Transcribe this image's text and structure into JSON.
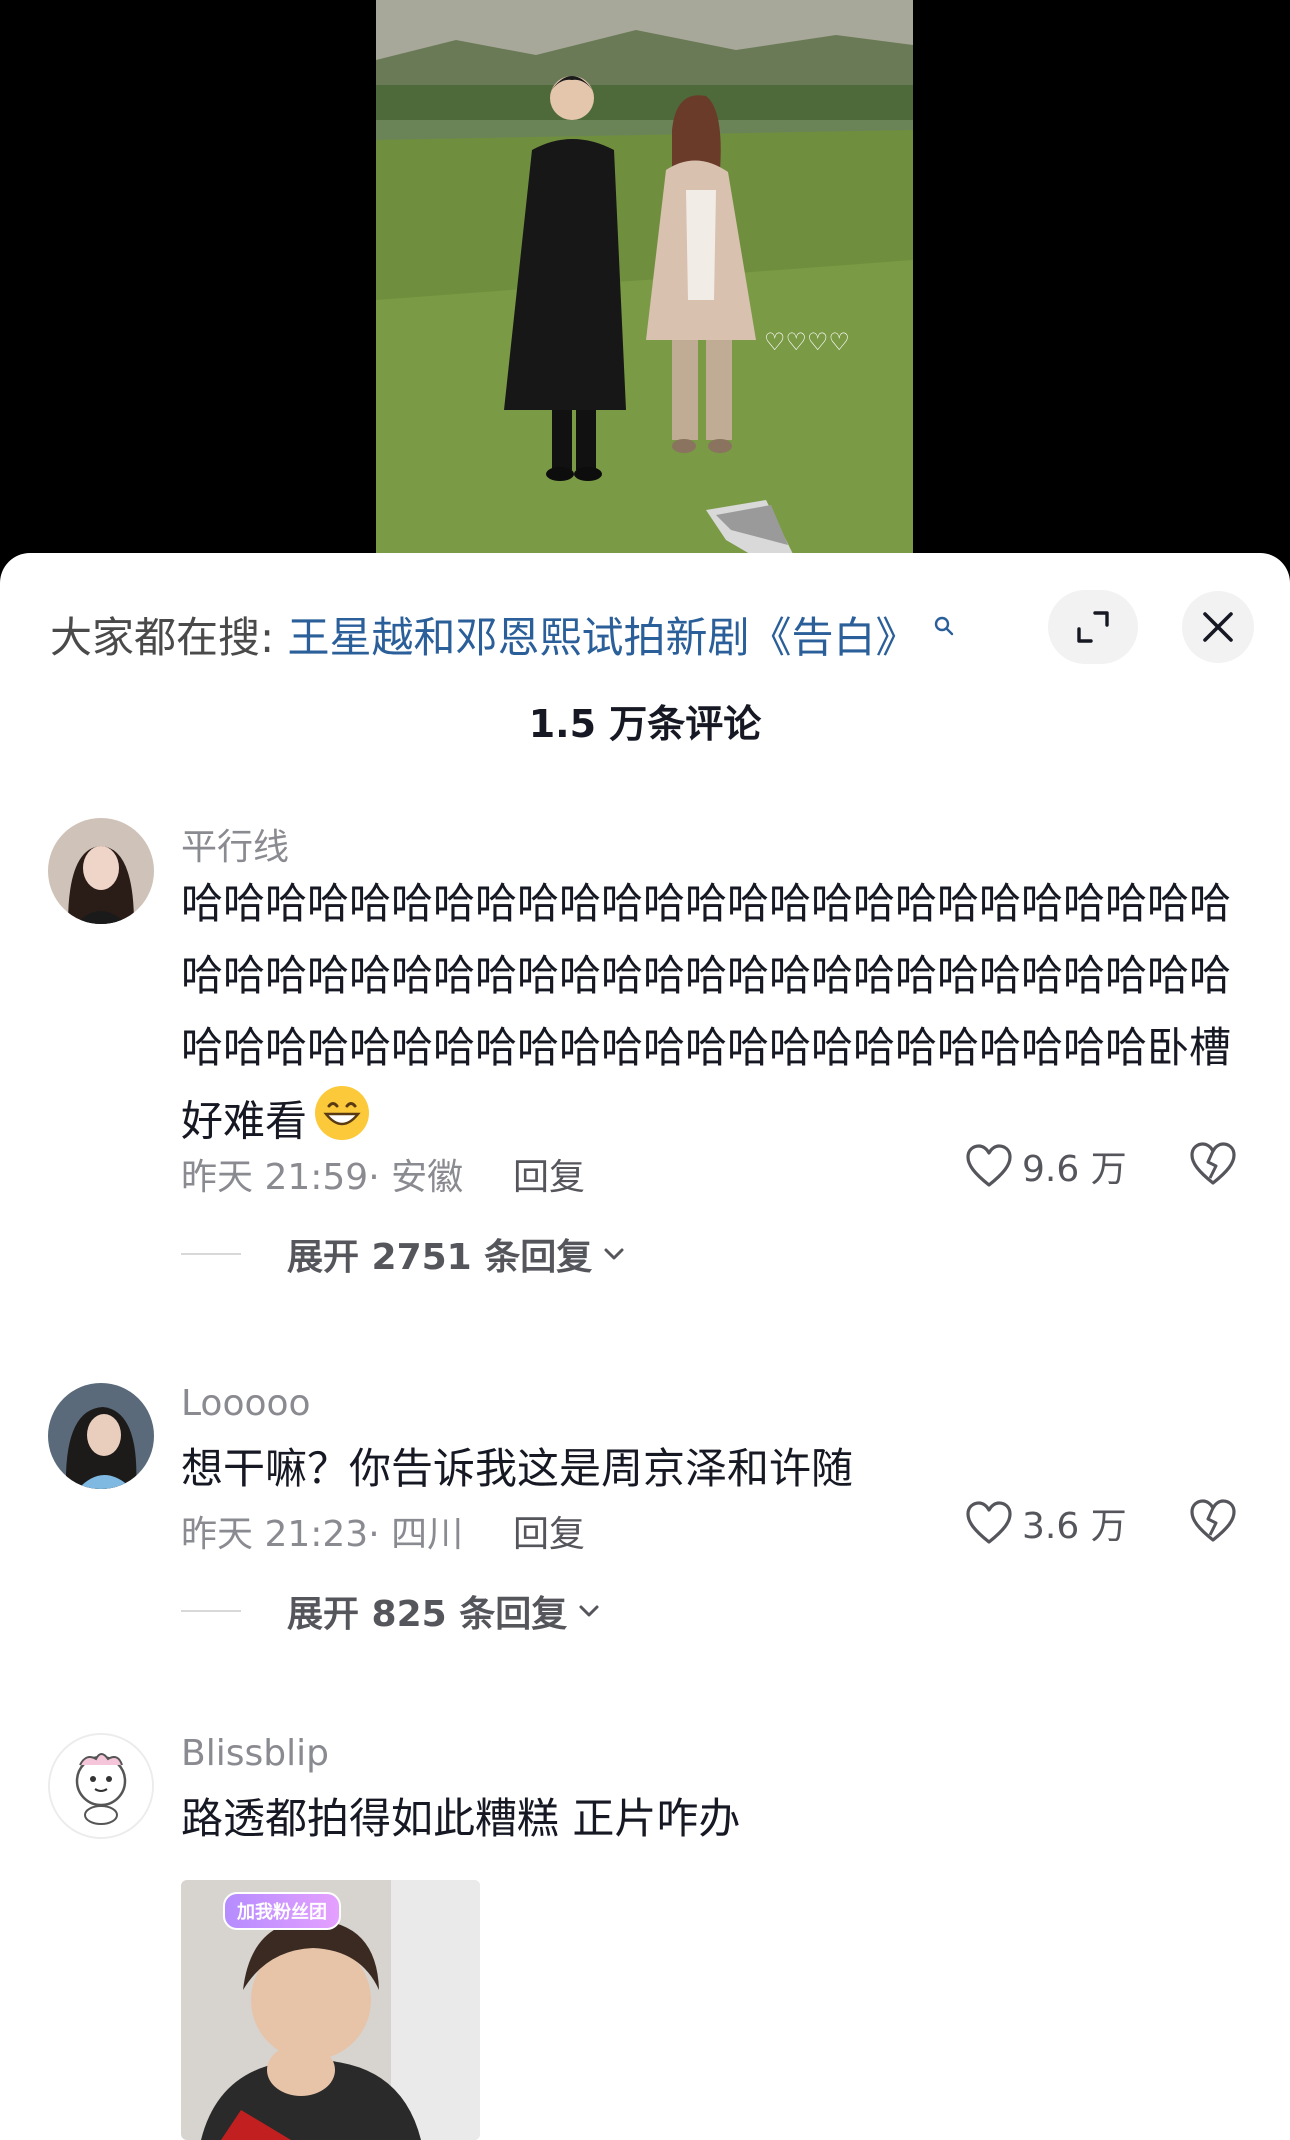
{
  "search_bar": {
    "prefix": "大家都在搜:",
    "query": "王星越和邓恩熙试拍新剧《告白》"
  },
  "comment_count_label": "1.5 万条评论",
  "comments": [
    {
      "username": "平行线",
      "text": "哈哈哈哈哈哈哈哈哈哈哈哈哈哈哈哈哈哈哈哈哈哈哈哈哈哈哈哈哈哈哈哈哈哈哈哈哈哈哈哈哈哈哈哈哈哈哈哈哈哈哈哈哈哈哈哈哈哈哈哈哈哈哈哈哈哈哈哈哈哈哈哈哈卧槽好难看",
      "emoji": "grinning-face-emoji",
      "time": "昨天 21:59",
      "location": "· 安徽",
      "reply_label": "回复",
      "likes": "9.6 万",
      "expand_label": "展开 2751 条回复"
    },
    {
      "username": "Looooo",
      "text": "想干嘛？你告诉我这是周京泽和许随",
      "time": "昨天 21:23",
      "location": "· 四川",
      "reply_label": "回复",
      "likes": "3.6 万",
      "expand_label": "展开 825 条回复"
    },
    {
      "username": "Blissblip",
      "text": "路透都拍得如此糟糕 正片咋办",
      "sticker_label": "加我粉丝团"
    }
  ],
  "colors": {
    "search_query": "#2b5f9a",
    "secondary_text": "#8a8b91",
    "background_top": "#000000"
  }
}
